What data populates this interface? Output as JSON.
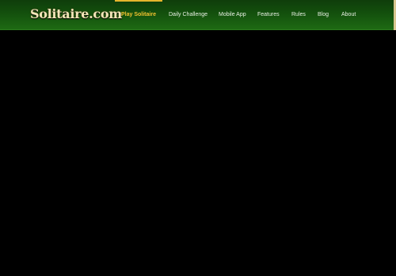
{
  "header": {
    "logo_text": "Solitaire.com",
    "nav": [
      {
        "label": "Play Solitaire",
        "active": true
      },
      {
        "label": "Daily Challenge",
        "active": false
      },
      {
        "label": "Mobile App",
        "active": false
      },
      {
        "label": "Features",
        "active": false
      },
      {
        "label": "Rules",
        "active": false
      },
      {
        "label": "Blog",
        "active": false
      },
      {
        "label": "About",
        "active": false
      }
    ]
  },
  "colors": {
    "header_green": "#13500d",
    "active_accent": "#f2c230",
    "logo_cream": "#f3e6b8",
    "background": "#000000"
  }
}
